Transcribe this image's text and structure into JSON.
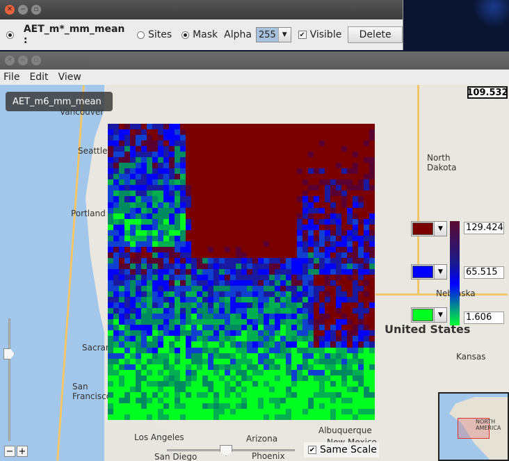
{
  "layer_window": {
    "layer_name": "AET_m*_mm_mean :",
    "sites_label": "Sites",
    "mask_label": "Mask",
    "alpha_label": "Alpha",
    "alpha_value": "255",
    "visible_label": "Visible",
    "delete_label": "Delete"
  },
  "menu": {
    "file": "File",
    "edit": "Edit",
    "view": "View"
  },
  "map": {
    "layer_label": "AET_m6_mm_mean",
    "cursor_value": "109.532",
    "cities": [
      "Vancouver",
      "Seattle",
      "Portland",
      "Sacramento",
      "San Francisco",
      "Los Angeles",
      "San Diego",
      "Arizona",
      "Phoenix",
      "Albuquerque",
      "New Mexico",
      "North Dakota",
      "Nebraska",
      "United States",
      "Kansas"
    ],
    "legend": {
      "max_value": "129.424",
      "mid_value": "65.515",
      "min_value": "1.606",
      "max_color": "#7a0000",
      "mid_color": "#0000ff",
      "min_color": "#00ff20"
    },
    "same_scale_label": "Same Scale",
    "zoom_out": "−",
    "zoom_in": "+",
    "inset_label": "NORTH AMERICA"
  }
}
